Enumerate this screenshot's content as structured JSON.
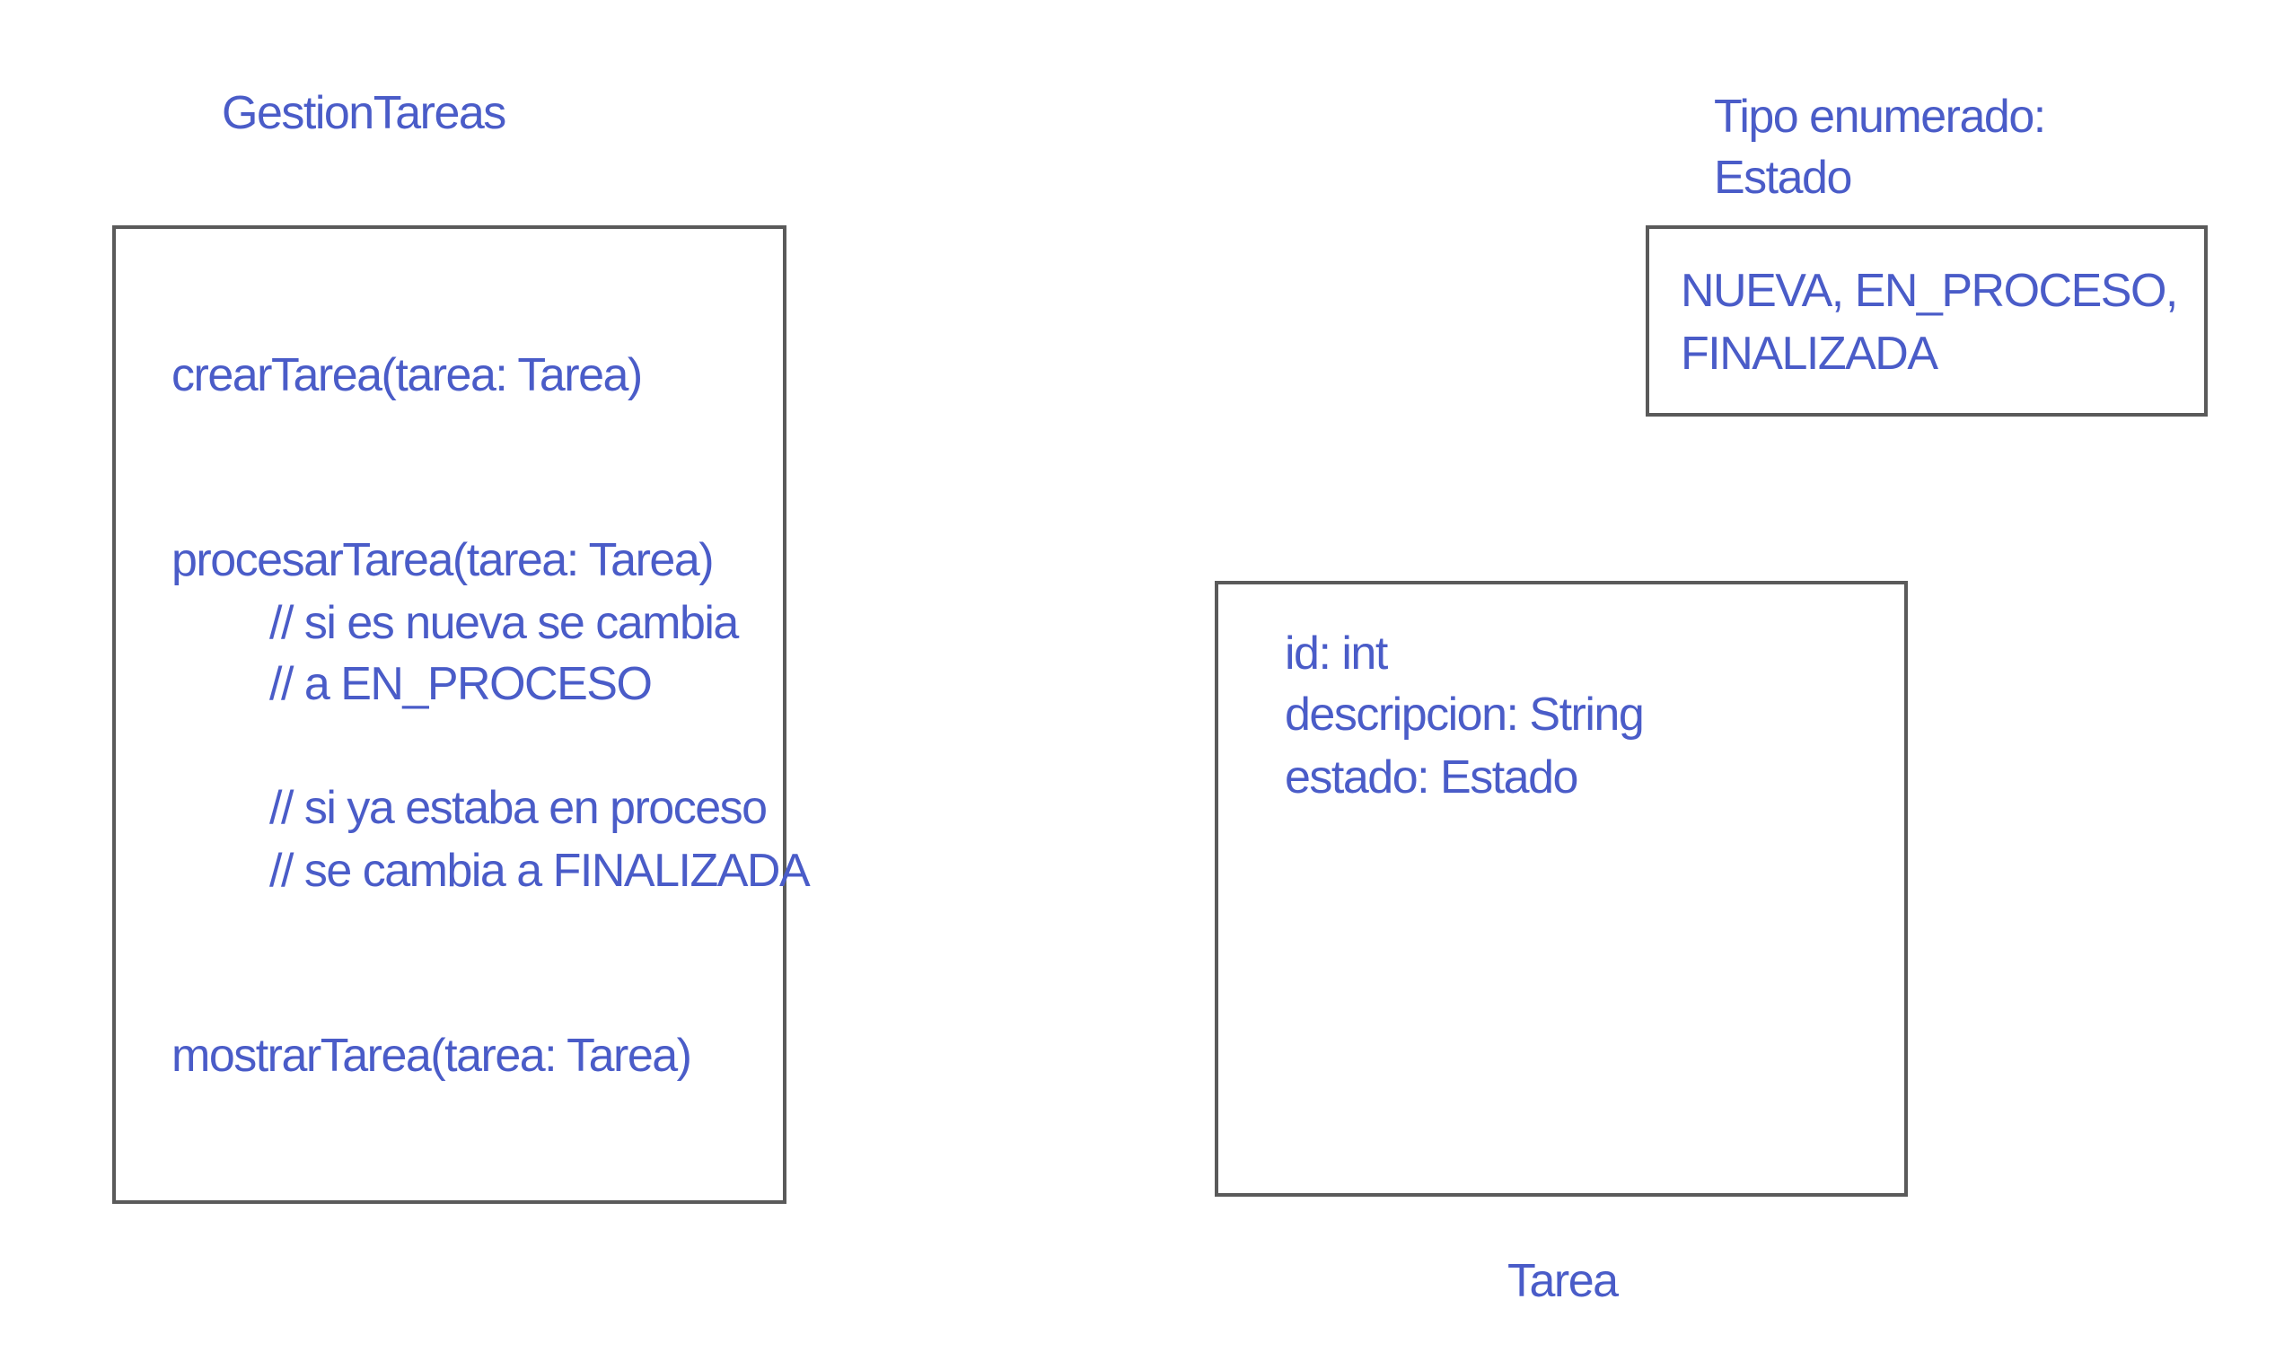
{
  "gestion": {
    "title": "GestionTareas",
    "methods": {
      "crear": "crearTarea(tarea: Tarea)",
      "procesar": "procesarTarea(tarea: Tarea)",
      "comment1": "// si es nueva se cambia",
      "comment2": "// a EN_PROCESO",
      "comment3": "// si ya estaba en proceso",
      "comment4": "// se cambia a FINALIZADA",
      "mostrar": "mostrarTarea(tarea: Tarea)"
    }
  },
  "estado": {
    "title_line1": "Tipo enumerado:",
    "title_line2": "Estado",
    "values_line1": "NUEVA, EN_PROCESO,",
    "values_line2": "FINALIZADA"
  },
  "tarea": {
    "title": "Tarea",
    "attributes": [
      "id: int",
      "descripcion: String",
      "estado: Estado"
    ]
  },
  "colors": {
    "text": "#4a5cc8",
    "border": "#5a5a5a"
  }
}
